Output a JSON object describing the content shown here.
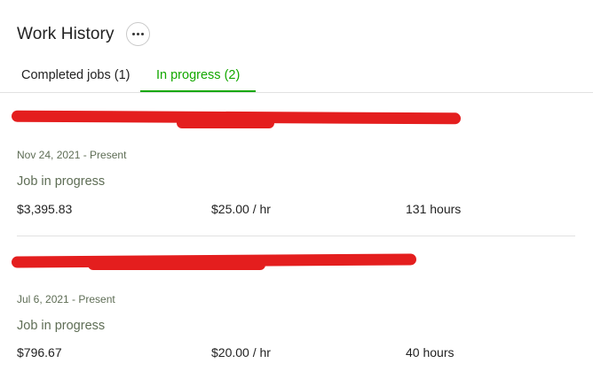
{
  "header": {
    "title": "Work History",
    "more_icon": "more-horizontal-icon"
  },
  "tabs": [
    {
      "label": "Completed jobs (1)",
      "active": false
    },
    {
      "label": "In progress (2)",
      "active": true
    }
  ],
  "accent_color": "#14a800",
  "redaction_color": "#e41e1e",
  "jobs": [
    {
      "title_redacted": true,
      "date_range": "Nov 24, 2021 - Present",
      "status": "Job in progress",
      "earnings": "$3,395.83",
      "rate": "$25.00",
      "rate_unit": "/ hr",
      "hours": "131",
      "hours_unit": "hours"
    },
    {
      "title_redacted": true,
      "date_range": "Jul 6, 2021 - Present",
      "status": "Job in progress",
      "earnings": "$796.67",
      "rate": "$20.00",
      "rate_unit": "/ hr",
      "hours": "40",
      "hours_unit": "hours"
    }
  ]
}
